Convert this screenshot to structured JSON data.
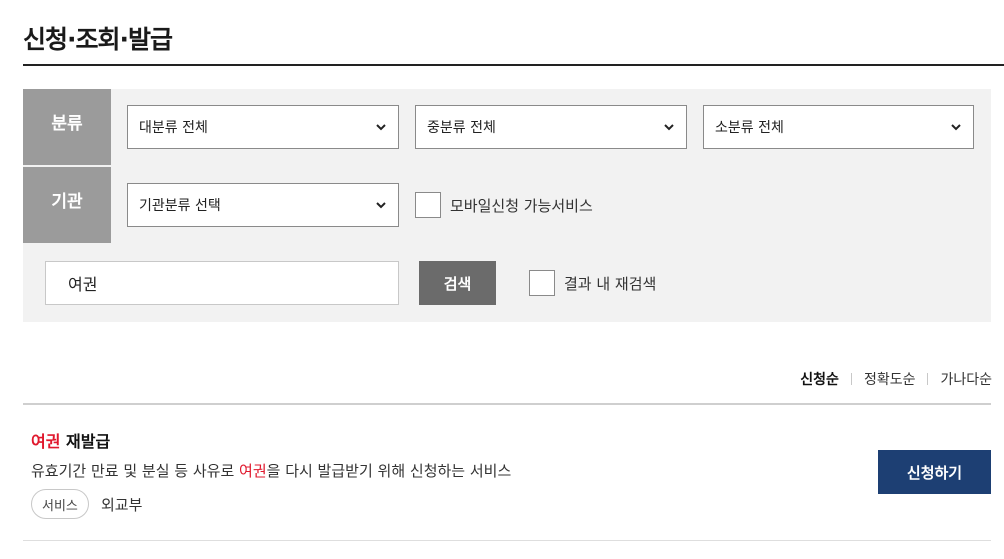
{
  "page_title": "신청·조회·발급",
  "filters": {
    "category_label": "분류",
    "agency_label": "기관",
    "major_category": "대분류 전체",
    "middle_category": "중분류 전체",
    "minor_category": "소분류 전체",
    "agency_select": "기관분류 선택",
    "mobile_checkbox_label": "모바일신청 가능서비스",
    "mobile_checked": false
  },
  "search": {
    "query": "여권",
    "button_label": "검색",
    "refine_label": "결과 내 재검색",
    "refine_checked": false
  },
  "sort": {
    "options": [
      "신청순",
      "정확도순",
      "가나다순"
    ],
    "active": "신청순"
  },
  "results": [
    {
      "title_highlight": "여권",
      "title_rest": " 재발급",
      "desc_before": "유효기간 만료 및 분실 등 사유로 ",
      "desc_highlight": "여권",
      "desc_after": "을 다시 발급받기 위해 신청하는 서비스",
      "tag": "서비스",
      "agency": "외교부",
      "apply_label": "신청하기"
    }
  ],
  "colors": {
    "label_bg": "#9b9b9b",
    "panel_bg": "#f2f2f2",
    "highlight": "#e0182d",
    "apply_btn": "#1d3f73",
    "search_btn": "#6b6b6b"
  }
}
